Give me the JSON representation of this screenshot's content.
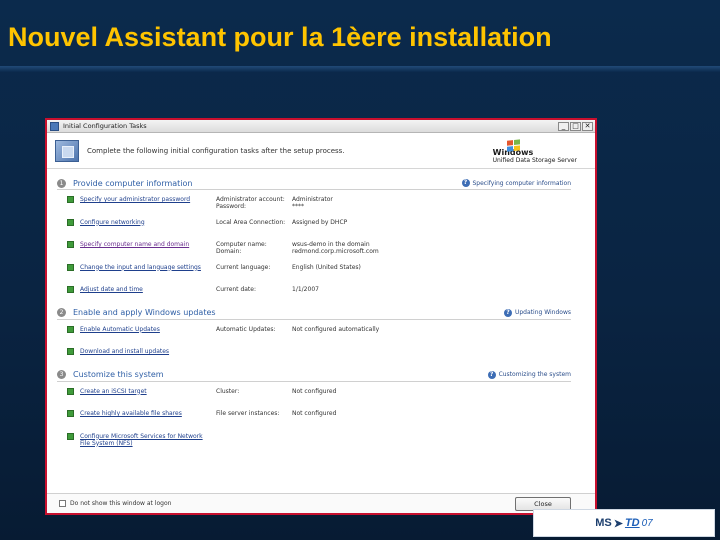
{
  "slide": {
    "title": "Nouvel Assistant pour la 1èere installation"
  },
  "window": {
    "title": "Initial Configuration Tasks",
    "controls": [
      "_",
      "□",
      "✕"
    ],
    "banner_text": "Complete the following initial configuration tasks after the setup process.",
    "logo_name": "Windows",
    "logo_sub": "Unified Data Storage Server",
    "sections": [
      {
        "number": "1",
        "title": "Provide computer information",
        "link": "Specifying computer information",
        "tasks": [
          {
            "link": "Specify your administrator password",
            "labels": [
              "Administrator account:",
              "Password:"
            ],
            "values": [
              "Administrator",
              "****"
            ]
          },
          {
            "link": "Configure networking",
            "labels": [
              "Local Area Connection:"
            ],
            "values": [
              "Assigned by DHCP"
            ]
          },
          {
            "link": "Specify computer name and domain",
            "labels": [
              "Computer name:",
              "Domain:"
            ],
            "values": [
              "wsus-demo in the domain",
              "redmond.corp.microsoft.com"
            ]
          },
          {
            "link": "Change the input and language settings",
            "labels": [
              "Current language:"
            ],
            "values": [
              "English (United States)"
            ]
          },
          {
            "link": "Adjust date and time",
            "labels": [
              "Current date:"
            ],
            "values": [
              "1/1/2007"
            ]
          }
        ]
      },
      {
        "number": "2",
        "title": "Enable and apply Windows updates",
        "link": "Updating Windows",
        "tasks": [
          {
            "link": "Enable Automatic Updates",
            "labels": [
              "Automatic Updates:"
            ],
            "values": [
              "Not configured automatically"
            ]
          },
          {
            "link": "Download and install updates",
            "labels": [],
            "values": []
          }
        ]
      },
      {
        "number": "3",
        "title": "Customize this system",
        "link": "Customizing the system",
        "tasks": [
          {
            "link": "Create an iSCSI target",
            "labels": [
              "Cluster:"
            ],
            "values": [
              "Not configured"
            ]
          },
          {
            "link": "Create highly available file shares",
            "labels": [
              "File server instances:"
            ],
            "values": [
              "Not configured"
            ]
          },
          {
            "link": "Configure Microsoft Services for Network File System (NFS)",
            "labels": [],
            "values": []
          }
        ]
      }
    ],
    "footer_checkbox_label": "Do not show this window at logon",
    "close_button": "Close"
  },
  "brand": {
    "ms": "MS",
    "td": "TD",
    "year": "07"
  }
}
